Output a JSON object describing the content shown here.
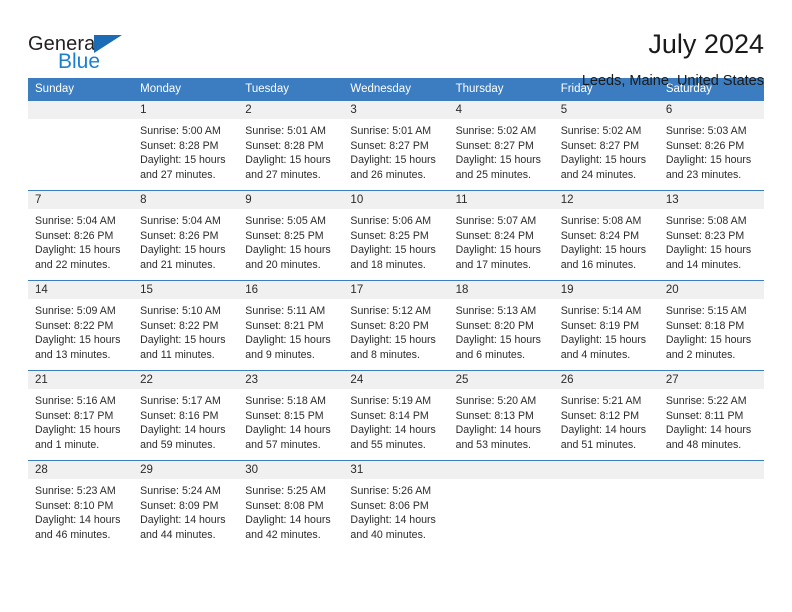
{
  "logo": {
    "primary_text": "General",
    "secondary_text": "Blue",
    "primary_color": "#231f20",
    "secondary_color": "#1b7fd4",
    "triangle_color": "#1b6cb5"
  },
  "header": {
    "title": "July 2024",
    "subtitle": "Leeds, Maine, United States"
  },
  "theme": {
    "header_row_bg": "#3b7dc0",
    "header_row_text": "#ffffff",
    "daynum_band_bg": "#f0f0f0",
    "cell_text": "#2b2b2b",
    "row_divider": "#3b7dc0"
  },
  "calendar": {
    "weekday_headers": [
      "Sunday",
      "Monday",
      "Tuesday",
      "Wednesday",
      "Thursday",
      "Friday",
      "Saturday"
    ],
    "weeks": [
      [
        {
          "day": "",
          "sunrise": "",
          "sunset": "",
          "daylight": ""
        },
        {
          "day": "1",
          "sunrise": "Sunrise: 5:00 AM",
          "sunset": "Sunset: 8:28 PM",
          "daylight": "Daylight: 15 hours and 27 minutes."
        },
        {
          "day": "2",
          "sunrise": "Sunrise: 5:01 AM",
          "sunset": "Sunset: 8:28 PM",
          "daylight": "Daylight: 15 hours and 27 minutes."
        },
        {
          "day": "3",
          "sunrise": "Sunrise: 5:01 AM",
          "sunset": "Sunset: 8:27 PM",
          "daylight": "Daylight: 15 hours and 26 minutes."
        },
        {
          "day": "4",
          "sunrise": "Sunrise: 5:02 AM",
          "sunset": "Sunset: 8:27 PM",
          "daylight": "Daylight: 15 hours and 25 minutes."
        },
        {
          "day": "5",
          "sunrise": "Sunrise: 5:02 AM",
          "sunset": "Sunset: 8:27 PM",
          "daylight": "Daylight: 15 hours and 24 minutes."
        },
        {
          "day": "6",
          "sunrise": "Sunrise: 5:03 AM",
          "sunset": "Sunset: 8:26 PM",
          "daylight": "Daylight: 15 hours and 23 minutes."
        }
      ],
      [
        {
          "day": "7",
          "sunrise": "Sunrise: 5:04 AM",
          "sunset": "Sunset: 8:26 PM",
          "daylight": "Daylight: 15 hours and 22 minutes."
        },
        {
          "day": "8",
          "sunrise": "Sunrise: 5:04 AM",
          "sunset": "Sunset: 8:26 PM",
          "daylight": "Daylight: 15 hours and 21 minutes."
        },
        {
          "day": "9",
          "sunrise": "Sunrise: 5:05 AM",
          "sunset": "Sunset: 8:25 PM",
          "daylight": "Daylight: 15 hours and 20 minutes."
        },
        {
          "day": "10",
          "sunrise": "Sunrise: 5:06 AM",
          "sunset": "Sunset: 8:25 PM",
          "daylight": "Daylight: 15 hours and 18 minutes."
        },
        {
          "day": "11",
          "sunrise": "Sunrise: 5:07 AM",
          "sunset": "Sunset: 8:24 PM",
          "daylight": "Daylight: 15 hours and 17 minutes."
        },
        {
          "day": "12",
          "sunrise": "Sunrise: 5:08 AM",
          "sunset": "Sunset: 8:24 PM",
          "daylight": "Daylight: 15 hours and 16 minutes."
        },
        {
          "day": "13",
          "sunrise": "Sunrise: 5:08 AM",
          "sunset": "Sunset: 8:23 PM",
          "daylight": "Daylight: 15 hours and 14 minutes."
        }
      ],
      [
        {
          "day": "14",
          "sunrise": "Sunrise: 5:09 AM",
          "sunset": "Sunset: 8:22 PM",
          "daylight": "Daylight: 15 hours and 13 minutes."
        },
        {
          "day": "15",
          "sunrise": "Sunrise: 5:10 AM",
          "sunset": "Sunset: 8:22 PM",
          "daylight": "Daylight: 15 hours and 11 minutes."
        },
        {
          "day": "16",
          "sunrise": "Sunrise: 5:11 AM",
          "sunset": "Sunset: 8:21 PM",
          "daylight": "Daylight: 15 hours and 9 minutes."
        },
        {
          "day": "17",
          "sunrise": "Sunrise: 5:12 AM",
          "sunset": "Sunset: 8:20 PM",
          "daylight": "Daylight: 15 hours and 8 minutes."
        },
        {
          "day": "18",
          "sunrise": "Sunrise: 5:13 AM",
          "sunset": "Sunset: 8:20 PM",
          "daylight": "Daylight: 15 hours and 6 minutes."
        },
        {
          "day": "19",
          "sunrise": "Sunrise: 5:14 AM",
          "sunset": "Sunset: 8:19 PM",
          "daylight": "Daylight: 15 hours and 4 minutes."
        },
        {
          "day": "20",
          "sunrise": "Sunrise: 5:15 AM",
          "sunset": "Sunset: 8:18 PM",
          "daylight": "Daylight: 15 hours and 2 minutes."
        }
      ],
      [
        {
          "day": "21",
          "sunrise": "Sunrise: 5:16 AM",
          "sunset": "Sunset: 8:17 PM",
          "daylight": "Daylight: 15 hours and 1 minute."
        },
        {
          "day": "22",
          "sunrise": "Sunrise: 5:17 AM",
          "sunset": "Sunset: 8:16 PM",
          "daylight": "Daylight: 14 hours and 59 minutes."
        },
        {
          "day": "23",
          "sunrise": "Sunrise: 5:18 AM",
          "sunset": "Sunset: 8:15 PM",
          "daylight": "Daylight: 14 hours and 57 minutes."
        },
        {
          "day": "24",
          "sunrise": "Sunrise: 5:19 AM",
          "sunset": "Sunset: 8:14 PM",
          "daylight": "Daylight: 14 hours and 55 minutes."
        },
        {
          "day": "25",
          "sunrise": "Sunrise: 5:20 AM",
          "sunset": "Sunset: 8:13 PM",
          "daylight": "Daylight: 14 hours and 53 minutes."
        },
        {
          "day": "26",
          "sunrise": "Sunrise: 5:21 AM",
          "sunset": "Sunset: 8:12 PM",
          "daylight": "Daylight: 14 hours and 51 minutes."
        },
        {
          "day": "27",
          "sunrise": "Sunrise: 5:22 AM",
          "sunset": "Sunset: 8:11 PM",
          "daylight": "Daylight: 14 hours and 48 minutes."
        }
      ],
      [
        {
          "day": "28",
          "sunrise": "Sunrise: 5:23 AM",
          "sunset": "Sunset: 8:10 PM",
          "daylight": "Daylight: 14 hours and 46 minutes."
        },
        {
          "day": "29",
          "sunrise": "Sunrise: 5:24 AM",
          "sunset": "Sunset: 8:09 PM",
          "daylight": "Daylight: 14 hours and 44 minutes."
        },
        {
          "day": "30",
          "sunrise": "Sunrise: 5:25 AM",
          "sunset": "Sunset: 8:08 PM",
          "daylight": "Daylight: 14 hours and 42 minutes."
        },
        {
          "day": "31",
          "sunrise": "Sunrise: 5:26 AM",
          "sunset": "Sunset: 8:06 PM",
          "daylight": "Daylight: 14 hours and 40 minutes."
        },
        {
          "day": "",
          "sunrise": "",
          "sunset": "",
          "daylight": ""
        },
        {
          "day": "",
          "sunrise": "",
          "sunset": "",
          "daylight": ""
        },
        {
          "day": "",
          "sunrise": "",
          "sunset": "",
          "daylight": ""
        }
      ]
    ]
  }
}
